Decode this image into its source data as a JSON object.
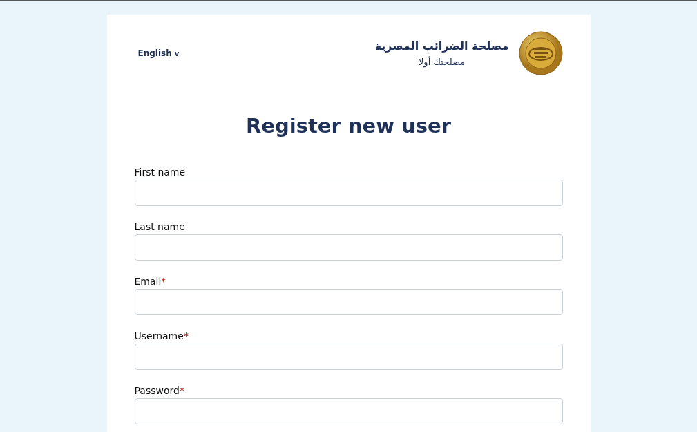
{
  "header": {
    "language": "English",
    "language_caret": "v",
    "org_name": "مصلحة الضرائب المصرية",
    "org_slogan": "مصلحتك أولا"
  },
  "title": "Register new user",
  "fields": [
    {
      "label": "First name"
    },
    {
      "label": "Last name"
    },
    {
      "label": "Email",
      "required_mark": "*"
    },
    {
      "label": "Username",
      "required_mark": "*"
    },
    {
      "label": "Password",
      "required_mark": "*"
    }
  ]
}
